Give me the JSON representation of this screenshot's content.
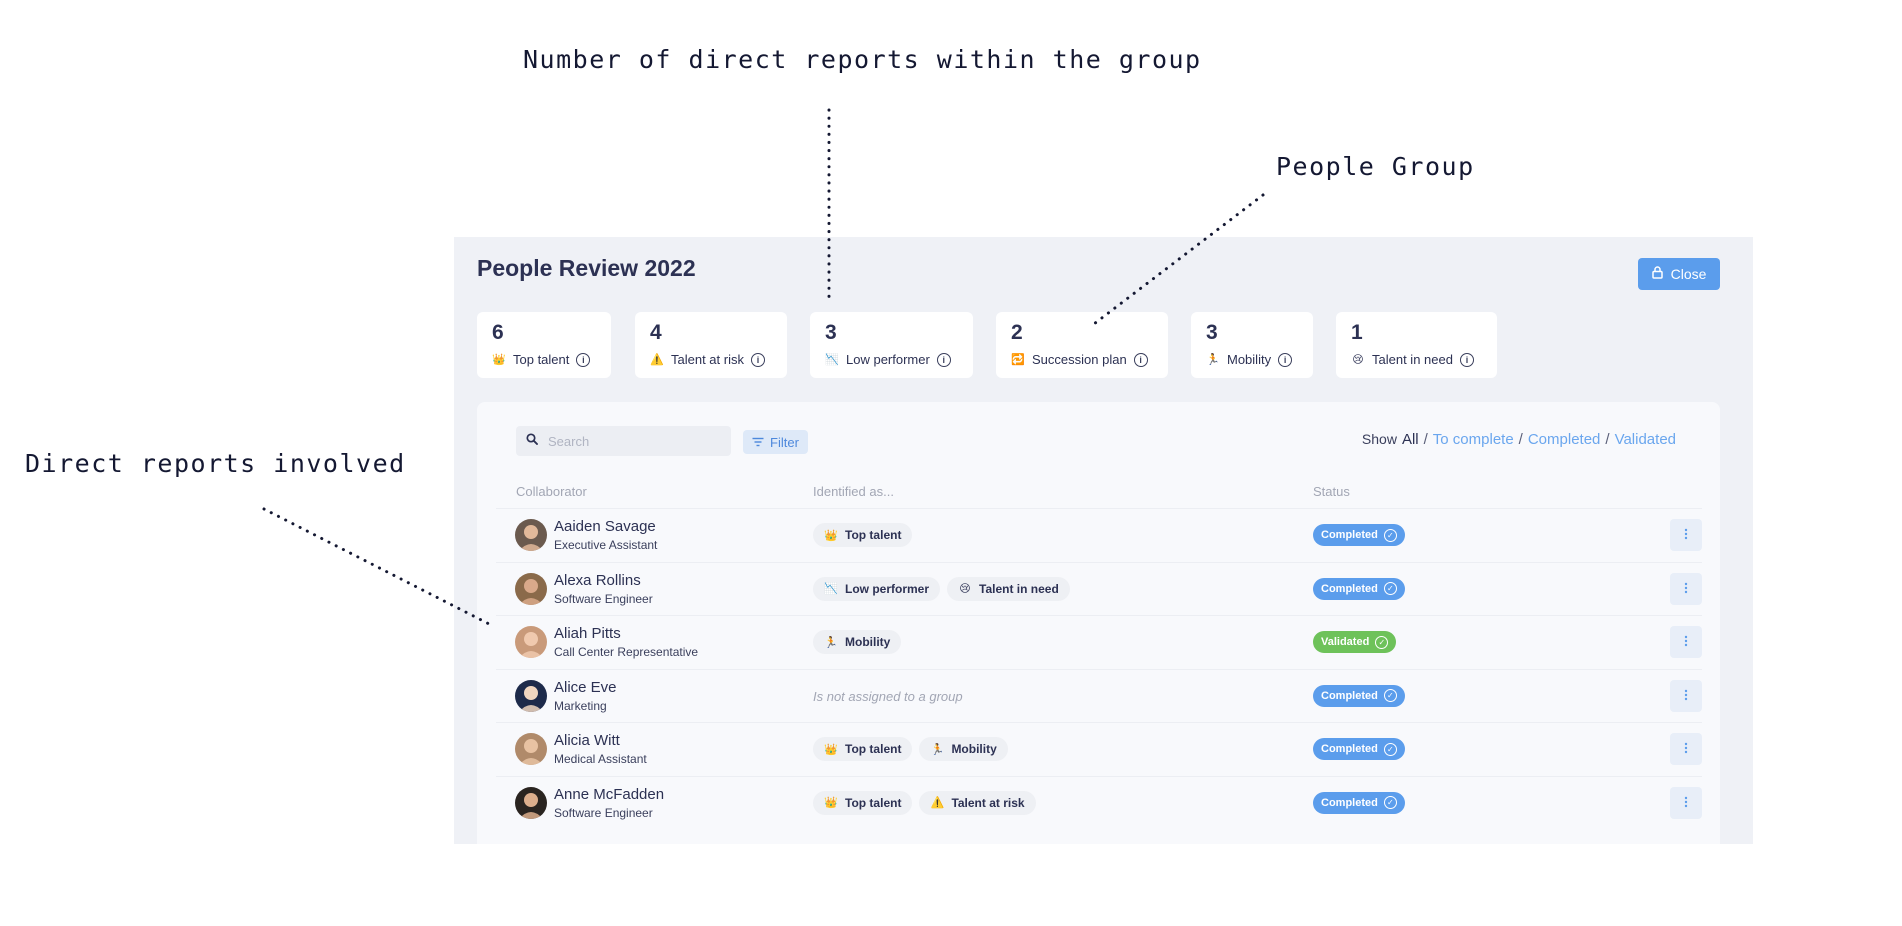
{
  "annotations": {
    "direct_reports_count": "Number of direct reports within the group",
    "people_group": "People Group",
    "direct_reports_involved": "Direct reports involved"
  },
  "header": {
    "title": "People Review 2022",
    "close_label": "Close"
  },
  "stats": [
    {
      "value": "6",
      "label": "Top talent",
      "icon": "crown-icon",
      "emoji": "👑"
    },
    {
      "value": "4",
      "label": "Talent at risk",
      "icon": "warning-icon",
      "emoji": "⚠️"
    },
    {
      "value": "3",
      "label": "Low performer",
      "icon": "chart-down-icon",
      "emoji": "📉"
    },
    {
      "value": "2",
      "label": "Succession plan",
      "icon": "repeat-icon",
      "emoji": "🔁"
    },
    {
      "value": "3",
      "label": "Mobility",
      "icon": "runner-icon",
      "emoji": "🏃"
    },
    {
      "value": "1",
      "label": "Talent in need",
      "icon": "crying-face-icon",
      "emoji": "😢"
    }
  ],
  "toolbar": {
    "search_placeholder": "Search",
    "filter_label": "Filter",
    "show_label": "Show",
    "show_options": [
      "All",
      "To complete",
      "Completed",
      "Validated"
    ],
    "show_selected": "All"
  },
  "table": {
    "headers": {
      "collaborator": "Collaborator",
      "identified_as": "Identified as...",
      "status": "Status"
    },
    "rows": [
      {
        "name": "Aaiden Savage",
        "role": "Executive Assistant",
        "avatar_bg": "#6b5a4e",
        "avatar_skin": "#e2b99a",
        "tags": [
          {
            "label": "Top talent",
            "emoji": "👑"
          }
        ],
        "status": "Completed"
      },
      {
        "name": "Alexa Rollins",
        "role": "Software Engineer",
        "avatar_bg": "#8a6a4a",
        "avatar_skin": "#d9a98a",
        "tags": [
          {
            "label": "Low performer",
            "emoji": "📉"
          },
          {
            "label": "Talent in need",
            "emoji": "😢"
          }
        ],
        "status": "Completed"
      },
      {
        "name": "Aliah Pitts",
        "role": "Call Center Representative",
        "avatar_bg": "#c99a7a",
        "avatar_skin": "#f0c9ae",
        "tags": [
          {
            "label": "Mobility",
            "emoji": "🏃"
          }
        ],
        "status": "Validated"
      },
      {
        "name": "Alice Eve",
        "role": "Marketing",
        "avatar_bg": "#1d2a4a",
        "avatar_skin": "#f0d6c0",
        "tags": [],
        "no_group": "Is not assigned to a group",
        "status": "Completed"
      },
      {
        "name": "Alicia Witt",
        "role": "Medical Assistant",
        "avatar_bg": "#b08a6a",
        "avatar_skin": "#e8c2a2",
        "tags": [
          {
            "label": "Top talent",
            "emoji": "👑"
          },
          {
            "label": "Mobility",
            "emoji": "🏃"
          }
        ],
        "status": "Completed"
      },
      {
        "name": "Anne McFadden",
        "role": "Software Engineer",
        "avatar_bg": "#2a2420",
        "avatar_skin": "#dcae8c",
        "tags": [
          {
            "label": "Top talent",
            "emoji": "👑"
          },
          {
            "label": "Talent at risk",
            "emoji": "⚠️"
          }
        ],
        "status": "Completed"
      }
    ]
  },
  "colors": {
    "accent": "#5b9dec",
    "completed": "#5b9dec",
    "validated": "#6ec25a",
    "panel_bg": "#eff1f6"
  }
}
